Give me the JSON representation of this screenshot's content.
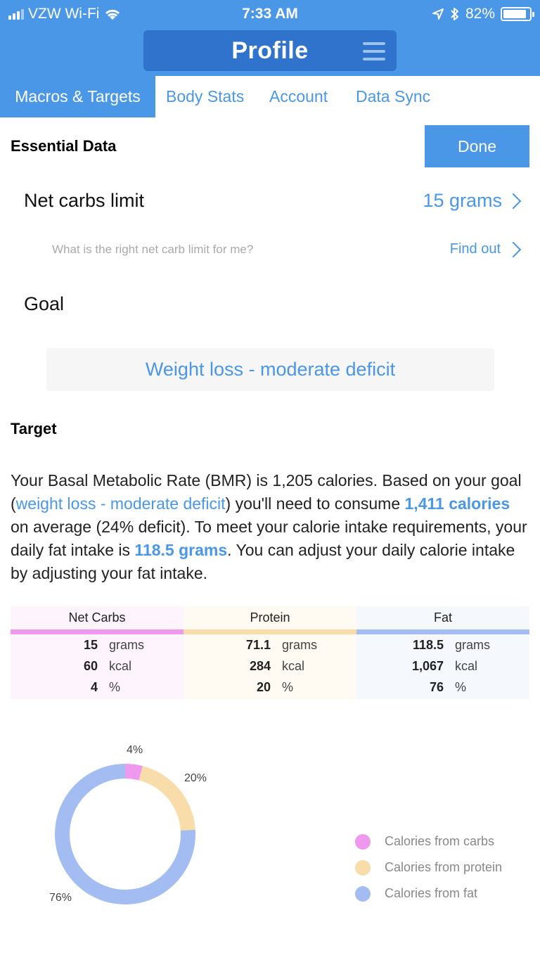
{
  "status_bar": {
    "carrier": "VZW Wi-Fi",
    "time": "7:33 AM",
    "battery": "82%"
  },
  "header": {
    "title": "Profile"
  },
  "tabs": [
    {
      "label": "Macros & Targets",
      "active": true
    },
    {
      "label": "Body Stats",
      "active": false
    },
    {
      "label": "Account",
      "active": false
    },
    {
      "label": "Data Sync",
      "active": false
    }
  ],
  "essential": {
    "title": "Essential Data",
    "done_label": "Done",
    "net_carbs_label": "Net carbs limit",
    "net_carbs_value": "15 grams",
    "question": "What is the right net carb limit for me?",
    "find_out": "Find out",
    "goal_label": "Goal",
    "goal_value": "Weight loss - moderate deficit"
  },
  "target": {
    "title": "Target",
    "p1": "Your Basal Metabolic Rate (BMR) is 1,205 calories. Based on your goal (",
    "goal_link": "weight loss - moderate deficit",
    "p2": ") you'll need to consume ",
    "calories": "1,411 calories",
    "p3": " on average (24% deficit). To meet your calorie intake requirements, your daily fat intake is ",
    "fat_grams": "118.5 grams",
    "p4": ". You can adjust your daily calorie intake by adjusting your fat intake."
  },
  "macros": [
    {
      "name": "Net Carbs",
      "grams": "15",
      "kcal": "60",
      "percent": "4",
      "color": "#ee99ee",
      "bg": "#fdf4fd"
    },
    {
      "name": "Protein",
      "grams": "71.1",
      "kcal": "284",
      "percent": "20",
      "color": "#f8ddaa",
      "bg": "#fffbf2"
    },
    {
      "name": "Fat",
      "grams": "118.5",
      "kcal": "1,067",
      "percent": "76",
      "color": "#a3bdf2",
      "bg": "#f5f8fd"
    }
  ],
  "units": {
    "grams": "grams",
    "kcal": "kcal",
    "percent": "%"
  },
  "chart_data": {
    "type": "pie",
    "categories": [
      "Calories from carbs",
      "Calories from protein",
      "Calories from fat"
    ],
    "values": [
      4,
      20,
      76
    ],
    "labels": [
      "4%",
      "20%",
      "76%"
    ],
    "colors": [
      "#ee99ee",
      "#f8ddaa",
      "#a3bdf2"
    ],
    "donut": true,
    "legend": "right"
  }
}
